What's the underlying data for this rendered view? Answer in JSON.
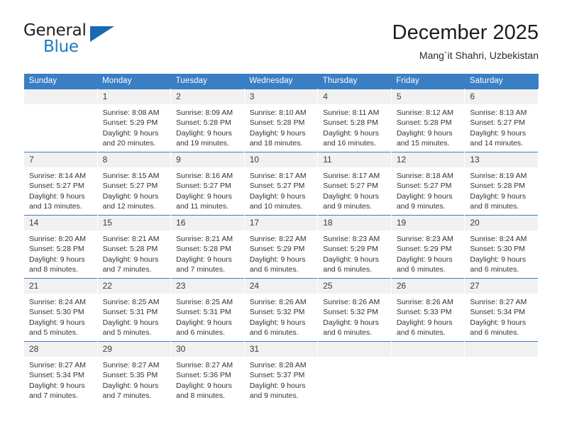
{
  "brand": {
    "name_part1": "General",
    "name_part2": "Blue",
    "triangle_icon": "brand-triangle-icon",
    "accent_color": "#1c7ac0"
  },
  "header": {
    "title": "December 2025",
    "subtitle": "Mang`it Shahri, Uzbekistan"
  },
  "calendar": {
    "header_bg": "#3a7ec4",
    "daynum_bg": "#f1f1f1",
    "weekday_headers": [
      "Sunday",
      "Monday",
      "Tuesday",
      "Wednesday",
      "Thursday",
      "Friday",
      "Saturday"
    ],
    "weeks": [
      [
        {
          "day": "",
          "blank": true,
          "sunrise": "",
          "sunset": "",
          "daylight_line1": "",
          "daylight_line2": ""
        },
        {
          "day": "1",
          "sunrise": "Sunrise: 8:08 AM",
          "sunset": "Sunset: 5:29 PM",
          "daylight_line1": "Daylight: 9 hours",
          "daylight_line2": "and 20 minutes."
        },
        {
          "day": "2",
          "sunrise": "Sunrise: 8:09 AM",
          "sunset": "Sunset: 5:28 PM",
          "daylight_line1": "Daylight: 9 hours",
          "daylight_line2": "and 19 minutes."
        },
        {
          "day": "3",
          "sunrise": "Sunrise: 8:10 AM",
          "sunset": "Sunset: 5:28 PM",
          "daylight_line1": "Daylight: 9 hours",
          "daylight_line2": "and 18 minutes."
        },
        {
          "day": "4",
          "sunrise": "Sunrise: 8:11 AM",
          "sunset": "Sunset: 5:28 PM",
          "daylight_line1": "Daylight: 9 hours",
          "daylight_line2": "and 16 minutes."
        },
        {
          "day": "5",
          "sunrise": "Sunrise: 8:12 AM",
          "sunset": "Sunset: 5:28 PM",
          "daylight_line1": "Daylight: 9 hours",
          "daylight_line2": "and 15 minutes."
        },
        {
          "day": "6",
          "sunrise": "Sunrise: 8:13 AM",
          "sunset": "Sunset: 5:27 PM",
          "daylight_line1": "Daylight: 9 hours",
          "daylight_line2": "and 14 minutes."
        }
      ],
      [
        {
          "day": "7",
          "sunrise": "Sunrise: 8:14 AM",
          "sunset": "Sunset: 5:27 PM",
          "daylight_line1": "Daylight: 9 hours",
          "daylight_line2": "and 13 minutes."
        },
        {
          "day": "8",
          "sunrise": "Sunrise: 8:15 AM",
          "sunset": "Sunset: 5:27 PM",
          "daylight_line1": "Daylight: 9 hours",
          "daylight_line2": "and 12 minutes."
        },
        {
          "day": "9",
          "sunrise": "Sunrise: 8:16 AM",
          "sunset": "Sunset: 5:27 PM",
          "daylight_line1": "Daylight: 9 hours",
          "daylight_line2": "and 11 minutes."
        },
        {
          "day": "10",
          "sunrise": "Sunrise: 8:17 AM",
          "sunset": "Sunset: 5:27 PM",
          "daylight_line1": "Daylight: 9 hours",
          "daylight_line2": "and 10 minutes."
        },
        {
          "day": "11",
          "sunrise": "Sunrise: 8:17 AM",
          "sunset": "Sunset: 5:27 PM",
          "daylight_line1": "Daylight: 9 hours",
          "daylight_line2": "and 9 minutes."
        },
        {
          "day": "12",
          "sunrise": "Sunrise: 8:18 AM",
          "sunset": "Sunset: 5:27 PM",
          "daylight_line1": "Daylight: 9 hours",
          "daylight_line2": "and 9 minutes."
        },
        {
          "day": "13",
          "sunrise": "Sunrise: 8:19 AM",
          "sunset": "Sunset: 5:28 PM",
          "daylight_line1": "Daylight: 9 hours",
          "daylight_line2": "and 8 minutes."
        }
      ],
      [
        {
          "day": "14",
          "sunrise": "Sunrise: 8:20 AM",
          "sunset": "Sunset: 5:28 PM",
          "daylight_line1": "Daylight: 9 hours",
          "daylight_line2": "and 8 minutes."
        },
        {
          "day": "15",
          "sunrise": "Sunrise: 8:21 AM",
          "sunset": "Sunset: 5:28 PM",
          "daylight_line1": "Daylight: 9 hours",
          "daylight_line2": "and 7 minutes."
        },
        {
          "day": "16",
          "sunrise": "Sunrise: 8:21 AM",
          "sunset": "Sunset: 5:28 PM",
          "daylight_line1": "Daylight: 9 hours",
          "daylight_line2": "and 7 minutes."
        },
        {
          "day": "17",
          "sunrise": "Sunrise: 8:22 AM",
          "sunset": "Sunset: 5:29 PM",
          "daylight_line1": "Daylight: 9 hours",
          "daylight_line2": "and 6 minutes."
        },
        {
          "day": "18",
          "sunrise": "Sunrise: 8:23 AM",
          "sunset": "Sunset: 5:29 PM",
          "daylight_line1": "Daylight: 9 hours",
          "daylight_line2": "and 6 minutes."
        },
        {
          "day": "19",
          "sunrise": "Sunrise: 8:23 AM",
          "sunset": "Sunset: 5:29 PM",
          "daylight_line1": "Daylight: 9 hours",
          "daylight_line2": "and 6 minutes."
        },
        {
          "day": "20",
          "sunrise": "Sunrise: 8:24 AM",
          "sunset": "Sunset: 5:30 PM",
          "daylight_line1": "Daylight: 9 hours",
          "daylight_line2": "and 6 minutes."
        }
      ],
      [
        {
          "day": "21",
          "sunrise": "Sunrise: 8:24 AM",
          "sunset": "Sunset: 5:30 PM",
          "daylight_line1": "Daylight: 9 hours",
          "daylight_line2": "and 5 minutes."
        },
        {
          "day": "22",
          "sunrise": "Sunrise: 8:25 AM",
          "sunset": "Sunset: 5:31 PM",
          "daylight_line1": "Daylight: 9 hours",
          "daylight_line2": "and 5 minutes."
        },
        {
          "day": "23",
          "sunrise": "Sunrise: 8:25 AM",
          "sunset": "Sunset: 5:31 PM",
          "daylight_line1": "Daylight: 9 hours",
          "daylight_line2": "and 6 minutes."
        },
        {
          "day": "24",
          "sunrise": "Sunrise: 8:26 AM",
          "sunset": "Sunset: 5:32 PM",
          "daylight_line1": "Daylight: 9 hours",
          "daylight_line2": "and 6 minutes."
        },
        {
          "day": "25",
          "sunrise": "Sunrise: 8:26 AM",
          "sunset": "Sunset: 5:32 PM",
          "daylight_line1": "Daylight: 9 hours",
          "daylight_line2": "and 6 minutes."
        },
        {
          "day": "26",
          "sunrise": "Sunrise: 8:26 AM",
          "sunset": "Sunset: 5:33 PM",
          "daylight_line1": "Daylight: 9 hours",
          "daylight_line2": "and 6 minutes."
        },
        {
          "day": "27",
          "sunrise": "Sunrise: 8:27 AM",
          "sunset": "Sunset: 5:34 PM",
          "daylight_line1": "Daylight: 9 hours",
          "daylight_line2": "and 6 minutes."
        }
      ],
      [
        {
          "day": "28",
          "sunrise": "Sunrise: 8:27 AM",
          "sunset": "Sunset: 5:34 PM",
          "daylight_line1": "Daylight: 9 hours",
          "daylight_line2": "and 7 minutes."
        },
        {
          "day": "29",
          "sunrise": "Sunrise: 8:27 AM",
          "sunset": "Sunset: 5:35 PM",
          "daylight_line1": "Daylight: 9 hours",
          "daylight_line2": "and 7 minutes."
        },
        {
          "day": "30",
          "sunrise": "Sunrise: 8:27 AM",
          "sunset": "Sunset: 5:36 PM",
          "daylight_line1": "Daylight: 9 hours",
          "daylight_line2": "and 8 minutes."
        },
        {
          "day": "31",
          "sunrise": "Sunrise: 8:28 AM",
          "sunset": "Sunset: 5:37 PM",
          "daylight_line1": "Daylight: 9 hours",
          "daylight_line2": "and 9 minutes."
        },
        {
          "day": "",
          "blank": true,
          "sunrise": "",
          "sunset": "",
          "daylight_line1": "",
          "daylight_line2": ""
        },
        {
          "day": "",
          "blank": true,
          "sunrise": "",
          "sunset": "",
          "daylight_line1": "",
          "daylight_line2": ""
        },
        {
          "day": "",
          "blank": true,
          "sunrise": "",
          "sunset": "",
          "daylight_line1": "",
          "daylight_line2": ""
        }
      ]
    ]
  }
}
